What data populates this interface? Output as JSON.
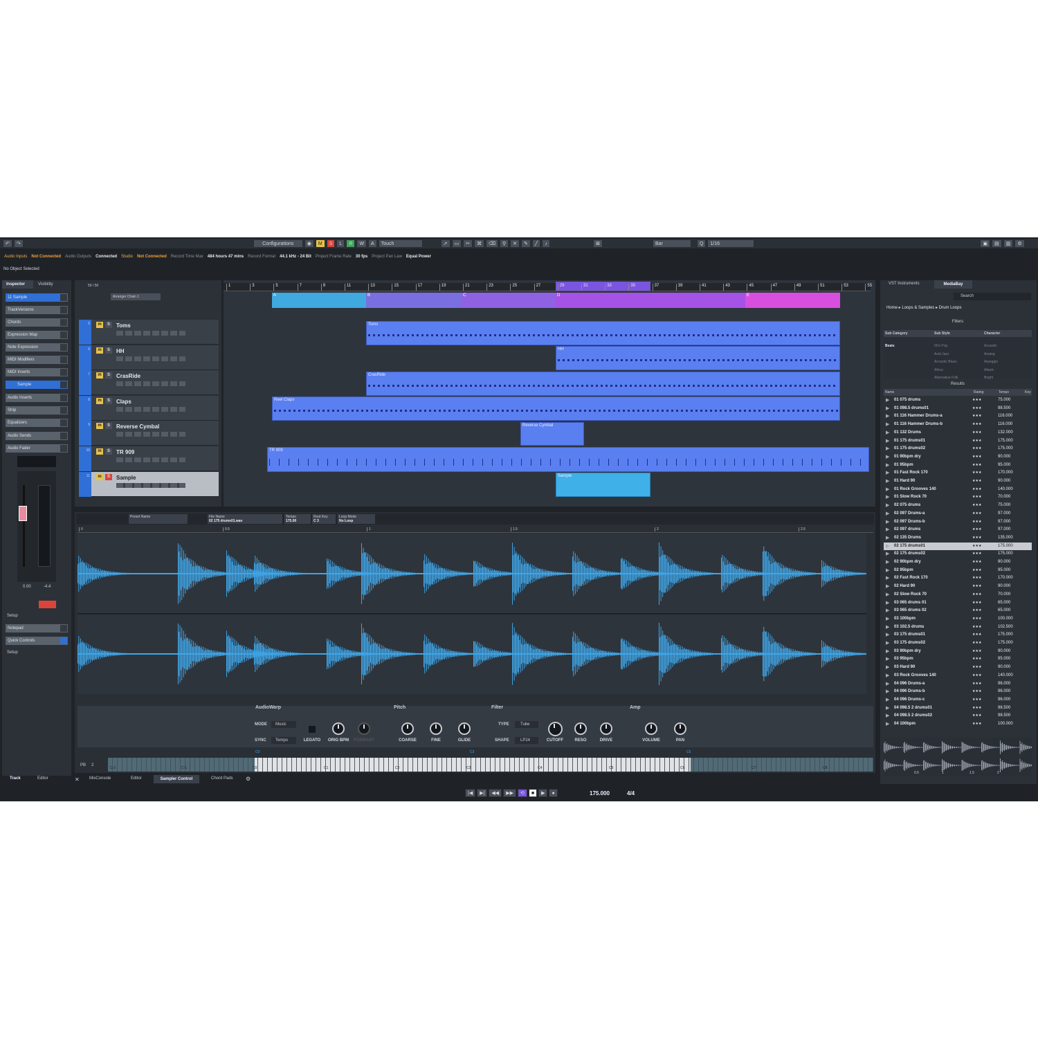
{
  "toolbar": {
    "configurations": "Configurations",
    "mode": "Touch",
    "quantize_type": "Bar",
    "quantize_value": "1/16",
    "marsrw": [
      "M",
      "S",
      "L",
      "R",
      "W",
      "A"
    ]
  },
  "status": {
    "audio_inputs_label": "Audio Inputs",
    "audio_inputs_value": "Not Connected",
    "audio_outputs_label": "Audio Outputs",
    "audio_outputs_value": "Connected",
    "studio_label": "Studio",
    "studio_value": "Not Connected",
    "rec_time_label": "Record Time Max",
    "rec_time_value": "484 hours 47 mins",
    "rec_format_label": "Record Format",
    "rec_format_value": "44.1 kHz - 24 Bit",
    "frame_rate_label": "Project Frame Rate",
    "frame_rate_value": "30 fps",
    "pan_law_label": "Project Pan Law",
    "pan_law_value": "Equal Power",
    "selection": "No Object Selected"
  },
  "inspector": {
    "tab_inspector": "Inspector",
    "tab_visibility": "Visibility",
    "track_name": "Sample",
    "track_num": "11",
    "sections": [
      "TrackVersions",
      "Chords",
      "Expression Map",
      "Note Expression",
      "MIDI Modifiers",
      "MIDI Inserts"
    ],
    "sample_label": "Sample",
    "sections2": [
      "Audio Inserts",
      "Strip",
      "Equalizers",
      "Audio Sends",
      "Audio Fader"
    ],
    "fader_value": "0.00",
    "fader_peak": "-4.4",
    "setup": "Setup",
    "notepad": "Notepad",
    "quick_controls": "Quick Controls",
    "setup2": "Setup",
    "bottom_tab_track": "Track",
    "bottom_tab_editor": "Editor"
  },
  "project": {
    "track_count": "50 / 50",
    "arranger_chain": "Arranger Chain 1",
    "ruler": [
      "1",
      "3",
      "5",
      "7",
      "9",
      "11",
      "13",
      "15",
      "17",
      "19",
      "21",
      "23",
      "25",
      "27",
      "29",
      "31",
      "33",
      "35",
      "37",
      "39",
      "41",
      "43",
      "45",
      "47",
      "49",
      "51",
      "53",
      "55"
    ],
    "arranger": [
      "A",
      "B",
      "C",
      "D",
      "E"
    ],
    "tracks": [
      {
        "name": "Toms",
        "num": "5"
      },
      {
        "name": "HH",
        "num": "6"
      },
      {
        "name": "CrasRide",
        "num": "7"
      },
      {
        "name": "Claps",
        "num": "8"
      },
      {
        "name": "Reverse Cymbal",
        "num": "9"
      },
      {
        "name": "TR 909",
        "num": "10"
      },
      {
        "name": "Sample",
        "num": "11"
      }
    ],
    "clips": {
      "toms": "Toms",
      "hh": "HH",
      "crasride": "CrasRide",
      "claps": "Reel Claps",
      "reverse": "Reverse Cymbal",
      "tr909": "TR 909",
      "sample": "Sample"
    }
  },
  "sampler": {
    "preset_label": "Preset Name",
    "file_label": "File Name",
    "file_value": "02 175 drums01.wav",
    "tempo_label": "Tempo",
    "tempo_value": "175.00",
    "root_label": "Root Key",
    "root_value": "C 3",
    "loop_label": "Loop Mode",
    "loop_value": "No Loop",
    "ruler": [
      "0",
      "0.5",
      "1",
      "1.5",
      "2",
      "2.5"
    ],
    "audiowarp": "AudioWarp",
    "mode_label": "MODE",
    "mode_value": "Music",
    "sync_label": "SYNC",
    "sync_value": "Tempo",
    "legato": "LEGATO",
    "orig_bpm": "ORIG BPM",
    "formant": "FORMANT",
    "pitch": "Pitch",
    "coarse": "COARSE",
    "fine": "FINE",
    "glide": "GLIDE",
    "filter": "Filter",
    "type_label": "TYPE",
    "type_value": "Tube",
    "shape_label": "SHAPE",
    "shape_value": "LP24",
    "cutoff": "CUTOFF",
    "reso": "RESO",
    "drive": "DRIVE",
    "amp": "Amp",
    "volume": "VOLUME",
    "pan": "PAN",
    "pb_label": "PB",
    "pb_value": "2",
    "keys": [
      "C-2",
      "C-1",
      "C0",
      "C1",
      "C2",
      "C3",
      "C4",
      "C5",
      "C6",
      "C7",
      "C8"
    ],
    "key_markers": [
      "C0",
      "C3",
      "C6"
    ]
  },
  "lower_zone": {
    "tabs": [
      "MixConsole",
      "Editor",
      "Sampler Control",
      "Chord Pads"
    ]
  },
  "transport": {
    "tempo": "175.000",
    "signature": "4/4"
  },
  "mediabay": {
    "tab_vst": "VST Instruments",
    "tab_mediabay": "MediaBay",
    "search": "Search",
    "breadcrumb": [
      "Home",
      "Loops & Samples",
      "Drum Loops"
    ],
    "filters_title": "Filters",
    "results_title": "Results",
    "filter_columns": [
      "Sub Category",
      "Sub Style",
      "Character"
    ],
    "filter_rows": [
      [
        "Beats",
        "60's Pop",
        "Acoustic"
      ],
      [
        "",
        "Acid Jazz",
        "Analog"
      ],
      [
        "",
        "Acoustic Blues",
        "Arpeggio"
      ],
      [
        "",
        "Africa",
        "Attack"
      ],
      [
        "",
        "Alternative Folk",
        "Bright"
      ]
    ],
    "result_columns": [
      "Name",
      "Rating",
      "Tempo",
      "Key"
    ],
    "results": [
      {
        "name": "01 075 drums",
        "rating": "★★★",
        "tempo": "75.000"
      },
      {
        "name": "01 098.5 drums01",
        "rating": "★★★",
        "tempo": "98.500"
      },
      {
        "name": "01 116 Hammer Drums-a",
        "rating": "★★★",
        "tempo": "116.000"
      },
      {
        "name": "01 116 Hammer Drums-b",
        "rating": "★★★",
        "tempo": "116.000"
      },
      {
        "name": "01 132 Drums",
        "rating": "★★★",
        "tempo": "132.000"
      },
      {
        "name": "01 175 drums01",
        "rating": "★★★",
        "tempo": "175.000"
      },
      {
        "name": "01 175 drums02",
        "rating": "★★★",
        "tempo": "175.000"
      },
      {
        "name": "01 90bpm dry",
        "rating": "★★★",
        "tempo": "90.000"
      },
      {
        "name": "01 95bpm",
        "rating": "★★★",
        "tempo": "95.000"
      },
      {
        "name": "01 Fast Rock 170",
        "rating": "★★★",
        "tempo": "170.000"
      },
      {
        "name": "01 Hard 90",
        "rating": "★★★",
        "tempo": "90.000"
      },
      {
        "name": "01 Rock Grooves 140",
        "rating": "★★★",
        "tempo": "140.000"
      },
      {
        "name": "01 Slow Rock 70",
        "rating": "★★★",
        "tempo": "70.000"
      },
      {
        "name": "02 075 drums",
        "rating": "★★★",
        "tempo": "75.000"
      },
      {
        "name": "02 097 Drums-a",
        "rating": "★★★",
        "tempo": "97.000"
      },
      {
        "name": "02 097 Drums-b",
        "rating": "★★★",
        "tempo": "97.000"
      },
      {
        "name": "02 097 drums",
        "rating": "★★★",
        "tempo": "97.000"
      },
      {
        "name": "02 135 Drums",
        "rating": "★★★",
        "tempo": "135.000"
      },
      {
        "name": "02 175 drums01",
        "rating": "★★★",
        "tempo": "175.000"
      },
      {
        "name": "02 175 drums02",
        "rating": "★★★",
        "tempo": "175.000"
      },
      {
        "name": "02 90bpm dry",
        "rating": "★★★",
        "tempo": "90.000"
      },
      {
        "name": "02 95bpm",
        "rating": "★★★",
        "tempo": "95.000"
      },
      {
        "name": "02 Fast Rock 170",
        "rating": "★★★",
        "tempo": "170.000"
      },
      {
        "name": "02 Hard 90",
        "rating": "★★★",
        "tempo": "90.000"
      },
      {
        "name": "02 Slow Rock 70",
        "rating": "★★★",
        "tempo": "70.000"
      },
      {
        "name": "03 065 drums 01",
        "rating": "★★★",
        "tempo": "65.000"
      },
      {
        "name": "03 065 drums 02",
        "rating": "★★★",
        "tempo": "65.000"
      },
      {
        "name": "03 100bpm",
        "rating": "★★★",
        "tempo": "100.000"
      },
      {
        "name": "03 102.5 drums",
        "rating": "★★★",
        "tempo": "102.500"
      },
      {
        "name": "03 175 drums01",
        "rating": "★★★",
        "tempo": "175.000"
      },
      {
        "name": "03 175 drums02",
        "rating": "★★★",
        "tempo": "175.000"
      },
      {
        "name": "03 90bpm dry",
        "rating": "★★★",
        "tempo": "90.000"
      },
      {
        "name": "03 95bpm",
        "rating": "★★★",
        "tempo": "95.000"
      },
      {
        "name": "03 Hard 90",
        "rating": "★★★",
        "tempo": "90.000"
      },
      {
        "name": "03 Rock Grooves 140",
        "rating": "★★★",
        "tempo": "140.000"
      },
      {
        "name": "04 096 Drums-a",
        "rating": "★★★",
        "tempo": "96.000"
      },
      {
        "name": "04 096 Drums-b",
        "rating": "★★★",
        "tempo": "96.000"
      },
      {
        "name": "04 096 Drums-c",
        "rating": "★★★",
        "tempo": "96.000"
      },
      {
        "name": "04 098.5 2 drums01",
        "rating": "★★★",
        "tempo": "98.500"
      },
      {
        "name": "04 098.5 2 drums02",
        "rating": "★★★",
        "tempo": "98.500"
      },
      {
        "name": "04 100bpm",
        "rating": "★★★",
        "tempo": "100.000"
      }
    ],
    "selected_index": 18,
    "preview_ruler": [
      "0.5",
      "1",
      "1.5",
      "2"
    ]
  },
  "colors": {
    "background": "#1f2328",
    "panel": "#2a2f36",
    "accent_blue": "#2f6fd6",
    "clip": "#5a7ff0",
    "waveform": "#3fa5e6",
    "arr_a": "#3fa9e0",
    "arr_b": "#7b6ee0",
    "arr_d": "#a453e6",
    "arr_e": "#d84fe0",
    "orange": "#f2a23c"
  }
}
